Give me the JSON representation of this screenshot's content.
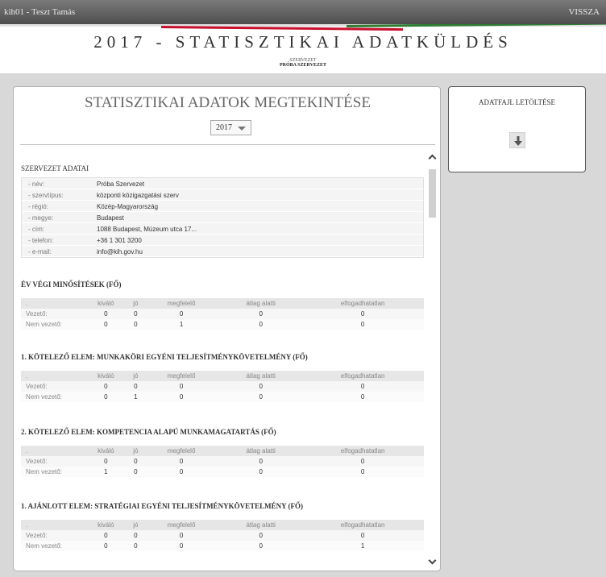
{
  "topbar": {
    "user": "kih01 - Teszt Tamás",
    "back_label": "VISSZA"
  },
  "header": {
    "title": "2017 - STATISZTIKAI ADATKÜLDÉS",
    "org_label": "SZERVEZET",
    "org_name": "PRÓBA SZERVEZET"
  },
  "panel": {
    "title": "STATISZTIKAI ADATOK MEGTEKINTÉSE",
    "year": "2017"
  },
  "org_section": {
    "title": "SZERVEZET ADATAI",
    "rows": [
      {
        "key": "- név:",
        "value": "Próba Szervezet"
      },
      {
        "key": "- szervtípus:",
        "value": "központi közigazgatási szerv"
      },
      {
        "key": "- régió:",
        "value": "Közép-Magyarország"
      },
      {
        "key": "- megye:",
        "value": "Budapest"
      },
      {
        "key": "- cím:",
        "value": "1088 Budapest, Múzeum utca 17..."
      },
      {
        "key": "- telefon:",
        "value": "+36 1 301 3200"
      },
      {
        "key": "- e-mail:",
        "value": "info@kih.gov.hu"
      }
    ]
  },
  "columns": [
    ".",
    "kiváló",
    "jó",
    "megfelelő",
    "átlag alatti",
    "elfogadhatatlan"
  ],
  "row_labels": [
    "Vezető:",
    "Nem vezető:"
  ],
  "sections": [
    {
      "title": "ÉV VÉGI MINŐSÍTÉSEK (FŐ)",
      "rows": [
        [
          "0",
          "0",
          "0",
          "0",
          "0"
        ],
        [
          "0",
          "0",
          "1",
          "0",
          "0"
        ]
      ]
    },
    {
      "title": "1. KÖTELEZŐ ELEM: MUNKAKÖRI EGYÉNI TELJESÍTMÉNYKÖVETELMÉNY (FŐ)",
      "rows": [
        [
          "0",
          "0",
          "0",
          "0",
          "0"
        ],
        [
          "0",
          "1",
          "0",
          "0",
          "0"
        ]
      ]
    },
    {
      "title": "2. KÖTELEZŐ ELEM: KOMPETENCIA ALAPÚ MUNKAMAGATARTÁS (FŐ)",
      "rows": [
        [
          "0",
          "0",
          "0",
          "0",
          "0"
        ],
        [
          "1",
          "0",
          "0",
          "0",
          "0"
        ]
      ]
    },
    {
      "title": "1. AJÁNLOTT ELEM: STRATÉGIAI EGYÉNI TELJESÍTMÉNYKÖVETELMÉNY (FŐ)",
      "rows": [
        [
          "0",
          "0",
          "0",
          "0",
          "0"
        ],
        [
          "0",
          "0",
          "0",
          "0",
          "1"
        ]
      ]
    }
  ],
  "download": {
    "title": "ADATFAJL LETÖLTÉSE",
    "icon": "download-arrow-icon"
  },
  "colors": {
    "stripe_red": "#c8102e",
    "stripe_green": "#2e7d32",
    "panel_bg": "#d8d8d8"
  }
}
